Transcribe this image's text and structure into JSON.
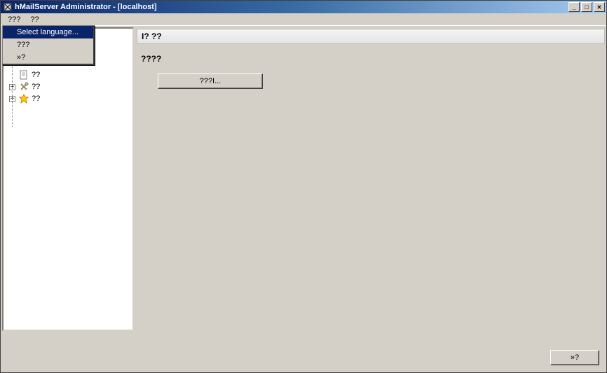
{
  "window": {
    "title": "hMailServer Administrator - [localhost]"
  },
  "menubar": {
    "items": [
      "???",
      "??"
    ]
  },
  "dropdown": {
    "items": [
      {
        "label": "Select language...",
        "highlight": true
      },
      {
        "label": "???",
        "highlight": false
      },
      {
        "label": "»?",
        "highlight": false
      }
    ]
  },
  "tree": {
    "nodes": [
      {
        "expand": "",
        "icon": "page-icon",
        "label": "??"
      },
      {
        "expand": "+",
        "icon": "tools-icon",
        "label": "??"
      },
      {
        "expand": "+",
        "icon": "star-icon",
        "label": "??"
      }
    ]
  },
  "content": {
    "header": "І? ??",
    "section": "????",
    "main_button": "???І..."
  },
  "footer": {
    "button": "»?"
  },
  "window_controls": {
    "min": "_",
    "max": "□",
    "close": "✕"
  }
}
